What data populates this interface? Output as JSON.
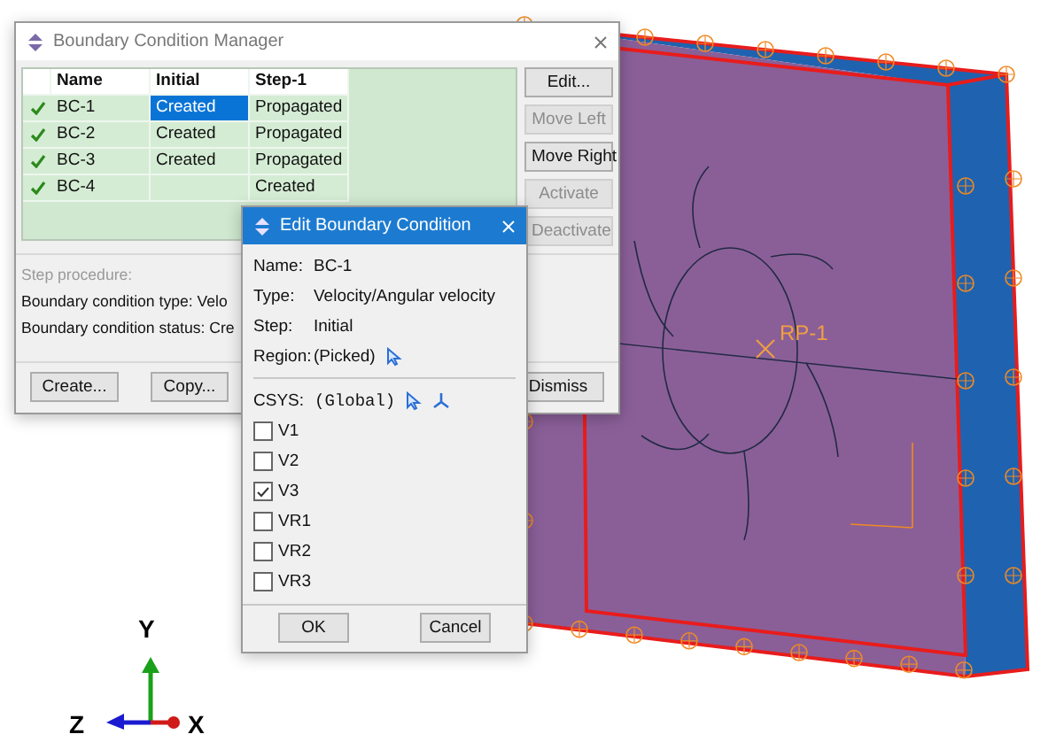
{
  "viewport": {
    "reference_point_label": "RP-1",
    "triad": {
      "x_label": "X",
      "y_label": "Y",
      "z_label": "Z"
    }
  },
  "manager": {
    "title": "Boundary Condition Manager",
    "columns": [
      "Name",
      "Initial",
      "Step-1"
    ],
    "rows": [
      {
        "enabled": true,
        "cells": [
          {
            "text": "BC-1",
            "selected": false
          },
          {
            "text": "Created",
            "selected": true
          },
          {
            "text": "Propagated",
            "selected": false
          }
        ]
      },
      {
        "enabled": true,
        "cells": [
          {
            "text": "BC-2",
            "selected": false
          },
          {
            "text": "Created",
            "selected": false
          },
          {
            "text": "Propagated",
            "selected": false
          }
        ]
      },
      {
        "enabled": true,
        "cells": [
          {
            "text": "BC-3",
            "selected": false
          },
          {
            "text": "Created",
            "selected": false
          },
          {
            "text": "Propagated",
            "selected": false
          }
        ]
      },
      {
        "enabled": true,
        "cells": [
          {
            "text": "BC-4",
            "selected": false
          },
          {
            "text": null,
            "selected": false
          },
          {
            "text": "Created",
            "selected": false
          }
        ]
      }
    ],
    "side_buttons": [
      {
        "label": "Edit...",
        "disabled": false
      },
      {
        "label": "Move Left",
        "disabled": true
      },
      {
        "label": "Move Right",
        "disabled": false
      },
      {
        "label": "Activate",
        "disabled": true
      },
      {
        "label": "Deactivate",
        "disabled": true
      }
    ],
    "info": [
      {
        "label": "Step procedure:",
        "disabled": true
      },
      {
        "label": "Boundary condition type:",
        "value": "Velo",
        "disabled": false
      },
      {
        "label": "Boundary condition status:",
        "value": "Cre",
        "disabled": false
      }
    ],
    "bottom_buttons": [
      "Create...",
      "Copy...",
      "Dismiss"
    ]
  },
  "edit_dialog": {
    "title": "Edit Boundary Condition",
    "fields": [
      {
        "label": "Name:",
        "value": "BC-1",
        "kind": "text"
      },
      {
        "label": "Type:",
        "value": "Velocity/Angular velocity",
        "kind": "text"
      },
      {
        "label": "Step:",
        "value": "Initial",
        "kind": "text"
      },
      {
        "label": "Region:",
        "value": "(Picked)",
        "kind": "pick"
      }
    ],
    "csys": {
      "label": "CSYS:",
      "value": "(Global)"
    },
    "components": [
      {
        "label": "V1",
        "checked": false
      },
      {
        "label": "V2",
        "checked": false
      },
      {
        "label": "V3",
        "checked": true
      },
      {
        "label": "VR1",
        "checked": false
      },
      {
        "label": "VR2",
        "checked": false
      },
      {
        "label": "VR3",
        "checked": false
      }
    ],
    "buttons": [
      "OK",
      "Cancel"
    ]
  }
}
